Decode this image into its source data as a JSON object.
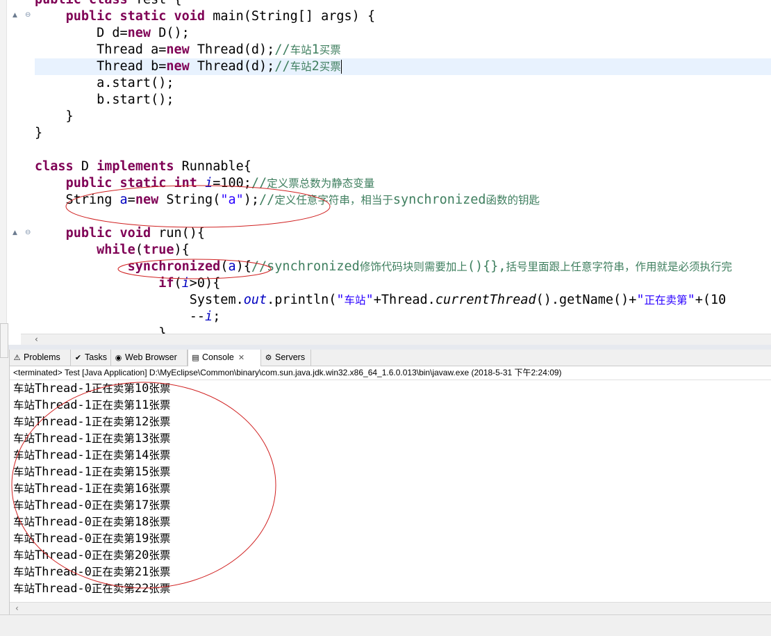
{
  "editor": {
    "lines": [
      {
        "parts": [
          [
            "kw",
            "public"
          ],
          [
            "t",
            " "
          ],
          [
            "kw",
            "class"
          ],
          [
            "t",
            " Test {"
          ]
        ]
      },
      {
        "parts": [
          [
            "t",
            "    "
          ],
          [
            "kw",
            "public"
          ],
          [
            "t",
            " "
          ],
          [
            "kw",
            "static"
          ],
          [
            "t",
            " "
          ],
          [
            "kw",
            "void"
          ],
          [
            "t",
            " main(String[] args) {"
          ]
        ]
      },
      {
        "parts": [
          [
            "t",
            "        D d="
          ],
          [
            "kw",
            "new"
          ],
          [
            "t",
            " D();"
          ]
        ]
      },
      {
        "parts": [
          [
            "t",
            "        Thread a="
          ],
          [
            "kw",
            "new"
          ],
          [
            "t",
            " Thread(d);"
          ],
          [
            "cm",
            "//"
          ],
          [
            "cmc",
            "车站"
          ],
          [
            "cm",
            "1"
          ],
          [
            "cmc",
            "买票"
          ]
        ]
      },
      {
        "parts": [
          [
            "t",
            "        Thread b="
          ],
          [
            "kw",
            "new"
          ],
          [
            "t",
            " Thread(d);"
          ],
          [
            "cm",
            "//"
          ],
          [
            "cmc",
            "车站"
          ],
          [
            "cm",
            "2"
          ],
          [
            "cmc",
            "买票"
          ]
        ],
        "highlight": true
      },
      {
        "parts": [
          [
            "t",
            "        a.start();"
          ]
        ]
      },
      {
        "parts": [
          [
            "t",
            "        b.start();"
          ]
        ]
      },
      {
        "parts": [
          [
            "t",
            "    }"
          ]
        ]
      },
      {
        "parts": [
          [
            "t",
            "}"
          ]
        ]
      },
      {
        "parts": [
          [
            "t",
            ""
          ]
        ]
      },
      {
        "parts": [
          [
            "kw",
            "class"
          ],
          [
            "t",
            " D "
          ],
          [
            "kw",
            "implements"
          ],
          [
            "t",
            " Runnable{"
          ]
        ]
      },
      {
        "parts": [
          [
            "t",
            "    "
          ],
          [
            "kw",
            "public"
          ],
          [
            "t",
            " "
          ],
          [
            "kw",
            "static"
          ],
          [
            "t",
            " "
          ],
          [
            "kw",
            "int"
          ],
          [
            "t",
            " "
          ],
          [
            "var",
            "i"
          ],
          [
            "t",
            "=100;"
          ],
          [
            "cm",
            "//"
          ],
          [
            "cmc",
            "定义票总数为静态变量"
          ]
        ]
      },
      {
        "parts": [
          [
            "t",
            "    String "
          ],
          [
            "fld",
            "a"
          ],
          [
            "t",
            "="
          ],
          [
            "kw",
            "new"
          ],
          [
            "t",
            " String("
          ],
          [
            "str",
            "\"a\""
          ],
          [
            "t",
            ");"
          ],
          [
            "cm",
            "//"
          ],
          [
            "cmc",
            "定义任意字符串，相当于"
          ],
          [
            "cm",
            "synchronized"
          ],
          [
            "cmc",
            "函数的钥匙"
          ]
        ]
      },
      {
        "parts": [
          [
            "t",
            ""
          ]
        ]
      },
      {
        "parts": [
          [
            "t",
            "    "
          ],
          [
            "kw",
            "public"
          ],
          [
            "t",
            " "
          ],
          [
            "kw",
            "void"
          ],
          [
            "t",
            " run(){"
          ]
        ]
      },
      {
        "parts": [
          [
            "t",
            "        "
          ],
          [
            "kw",
            "while"
          ],
          [
            "t",
            "("
          ],
          [
            "kw",
            "true"
          ],
          [
            "t",
            "){"
          ]
        ]
      },
      {
        "parts": [
          [
            "t",
            "            "
          ],
          [
            "kw",
            "synchronized"
          ],
          [
            "t",
            "("
          ],
          [
            "fld",
            "a"
          ],
          [
            "t",
            "){"
          ],
          [
            "cm",
            "//synchronized"
          ],
          [
            "cmc",
            "修饰代码块则需要加上"
          ],
          [
            "cm",
            "(){},"
          ],
          [
            "cmc",
            "括号里面跟上任意字符串，作用就是必须执行完"
          ]
        ]
      },
      {
        "parts": [
          [
            "t",
            "                "
          ],
          [
            "kw",
            "if"
          ],
          [
            "t",
            "("
          ],
          [
            "var",
            "i"
          ],
          [
            "t",
            ">0){"
          ]
        ]
      },
      {
        "parts": [
          [
            "t",
            "                    System."
          ],
          [
            "sf",
            "out"
          ],
          [
            "t",
            ".println("
          ],
          [
            "str",
            "\""
          ],
          [
            "strc",
            "车站"
          ],
          [
            "str",
            "\""
          ],
          [
            "t",
            "+Thread."
          ],
          [
            "it",
            "currentThread"
          ],
          [
            "t",
            "().getName()+"
          ],
          [
            "str",
            "\""
          ],
          [
            "strc",
            "正在卖第"
          ],
          [
            "str",
            "\""
          ],
          [
            "t",
            "+(10"
          ]
        ]
      },
      {
        "parts": [
          [
            "t",
            "                    --"
          ],
          [
            "var",
            "i"
          ],
          [
            "t",
            ";"
          ]
        ]
      },
      {
        "parts": [
          [
            "t",
            "                }"
          ]
        ]
      }
    ]
  },
  "tabs": [
    {
      "label": "Problems",
      "icon": "problems-icon",
      "glyph": "⚠"
    },
    {
      "label": "Tasks",
      "icon": "tasks-icon",
      "glyph": "✔"
    },
    {
      "label": "Web Browser",
      "icon": "globe-icon",
      "glyph": "◉"
    },
    {
      "label": "Console",
      "icon": "console-icon",
      "glyph": "▤",
      "close": "✕"
    },
    {
      "label": "Servers",
      "icon": "servers-icon",
      "glyph": "⚙"
    }
  ],
  "console": {
    "header": "<terminated> Test [Java Application] D:\\MyEclipse\\Common\\binary\\com.sun.java.jdk.win32.x86_64_1.6.0.013\\bin\\javaw.exe (2018-5-31 下午2:24:09)",
    "output": [
      [
        "车站",
        "Thread-1",
        "正在卖第",
        "10",
        "张票"
      ],
      [
        "车站",
        "Thread-1",
        "正在卖第",
        "11",
        "张票"
      ],
      [
        "车站",
        "Thread-1",
        "正在卖第",
        "12",
        "张票"
      ],
      [
        "车站",
        "Thread-1",
        "正在卖第",
        "13",
        "张票"
      ],
      [
        "车站",
        "Thread-1",
        "正在卖第",
        "14",
        "张票"
      ],
      [
        "车站",
        "Thread-1",
        "正在卖第",
        "15",
        "张票"
      ],
      [
        "车站",
        "Thread-1",
        "正在卖第",
        "16",
        "张票"
      ],
      [
        "车站",
        "Thread-0",
        "正在卖第",
        "17",
        "张票"
      ],
      [
        "车站",
        "Thread-0",
        "正在卖第",
        "18",
        "张票"
      ],
      [
        "车站",
        "Thread-0",
        "正在卖第",
        "19",
        "张票"
      ],
      [
        "车站",
        "Thread-0",
        "正在卖第",
        "20",
        "张票"
      ],
      [
        "车站",
        "Thread-0",
        "正在卖第",
        "21",
        "张票"
      ],
      [
        "车站",
        "Thread-0",
        "正在卖第",
        "22",
        "张票"
      ]
    ]
  },
  "colors": {
    "keyword": "#7f0055",
    "string": "#2a00ff",
    "comment": "#3f7f5f",
    "field": "#0000c0",
    "annotation": "#d02020"
  }
}
